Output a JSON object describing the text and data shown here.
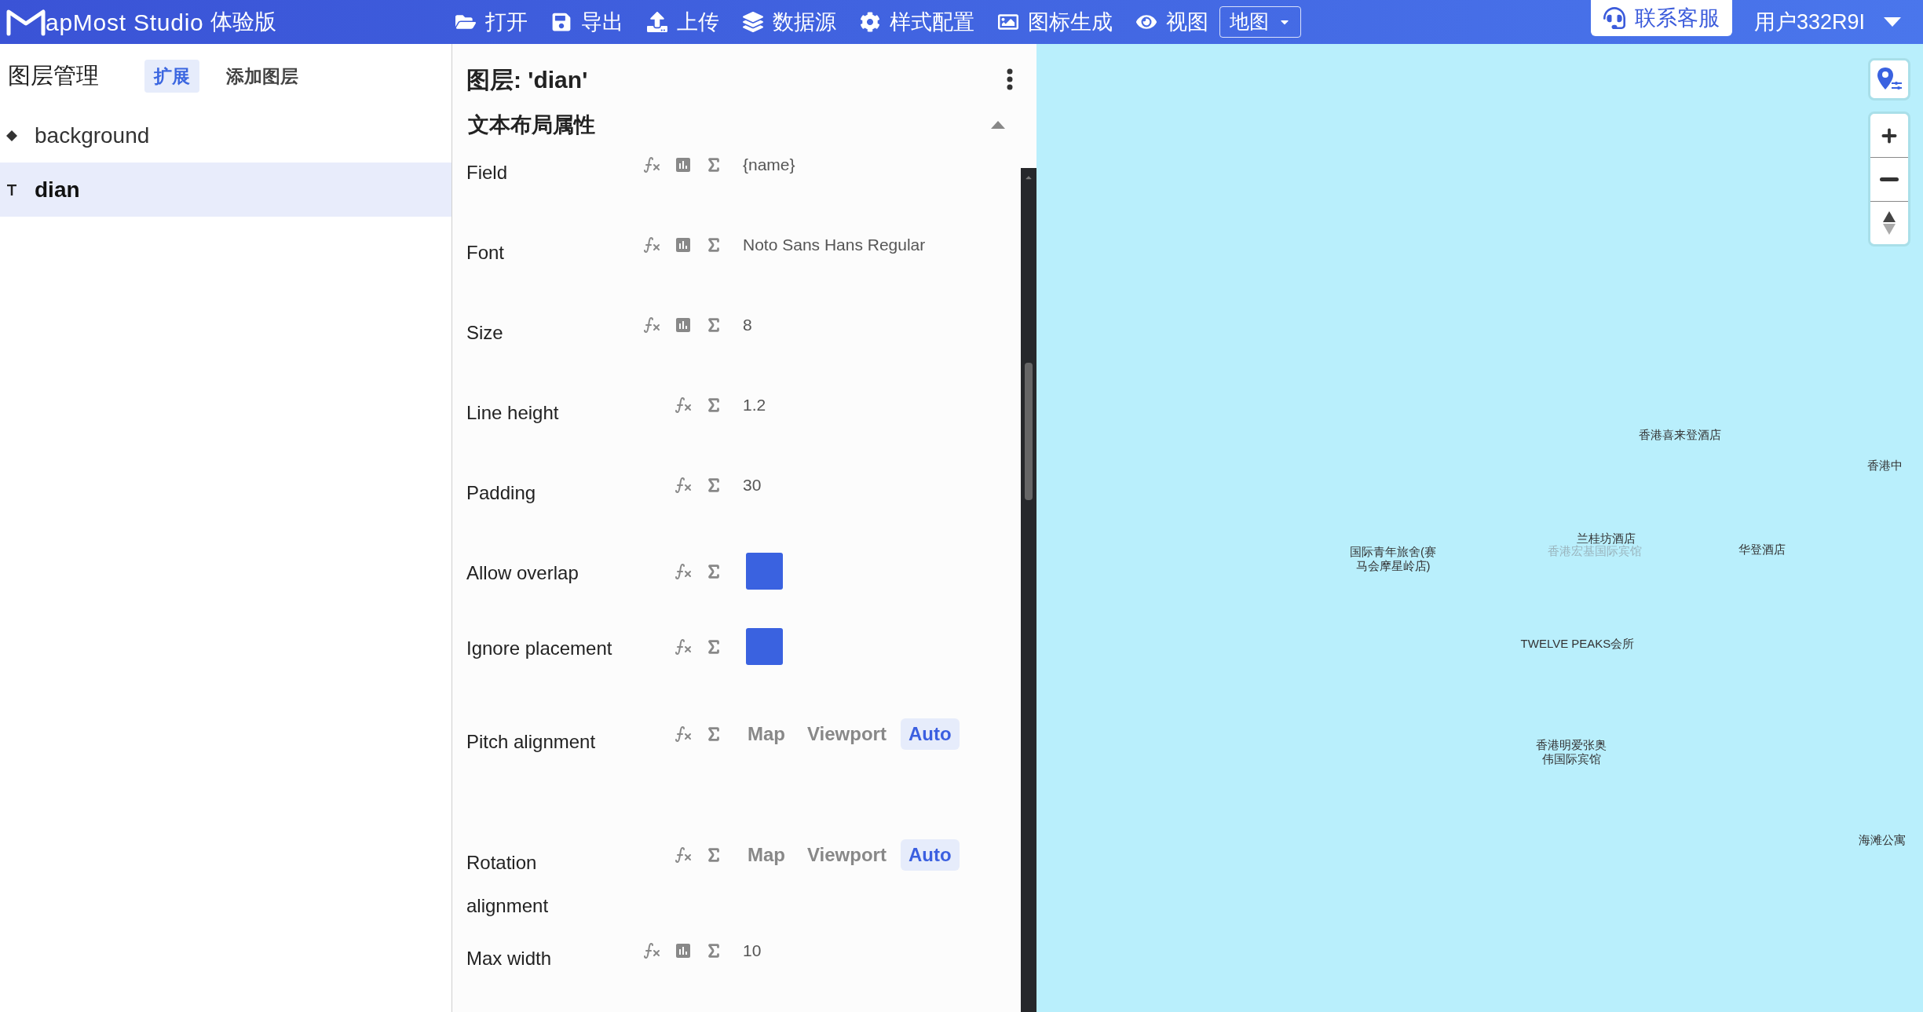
{
  "topbar": {
    "brand": "apMost Studio",
    "edition": "体验版",
    "menu": [
      {
        "kind": "open",
        "label": "打开"
      },
      {
        "kind": "save",
        "label": "导出"
      },
      {
        "kind": "upload",
        "label": "上传"
      },
      {
        "kind": "layers",
        "label": "数据源"
      },
      {
        "kind": "settings",
        "label": "样式配置"
      },
      {
        "kind": "image",
        "label": "图标生成"
      },
      {
        "kind": "view",
        "label": "视图"
      }
    ],
    "view_select": "地图",
    "support": "联系客服",
    "user": "用户332R9I"
  },
  "layers_panel": {
    "title": "图层管理",
    "actions": [
      {
        "label": "扩展",
        "selected": true
      },
      {
        "label": "添加图层",
        "selected": false
      }
    ],
    "layers": [
      {
        "kind": "fill",
        "name": "background",
        "selected": false
      },
      {
        "kind": "symbol",
        "name": "dian",
        "selected": true
      }
    ]
  },
  "editor": {
    "title": "图层: 'dian'",
    "section": {
      "title": "文本布局属性",
      "expanded": true
    },
    "properties": [
      {
        "kind": "text",
        "label": "Field",
        "data_driven": true,
        "value": "{name}"
      },
      {
        "kind": "text",
        "label": "Font",
        "data_driven": true,
        "value": "Noto Sans Hans Regular"
      },
      {
        "kind": "text",
        "label": "Size",
        "data_driven": true,
        "value": "8"
      },
      {
        "kind": "text",
        "label": "Line height",
        "data_driven": false,
        "value": "1.2"
      },
      {
        "kind": "text",
        "label": "Padding",
        "data_driven": false,
        "value": "30"
      },
      {
        "kind": "bool",
        "label": "Allow overlap",
        "data_driven": false,
        "checked": true
      },
      {
        "kind": "bool",
        "label": "Ignore placement",
        "data_driven": false,
        "checked": true
      },
      {
        "kind": "enum",
        "label": "Pitch alignment",
        "data_driven": false,
        "options": [
          {
            "label": "Map",
            "selected": false
          },
          {
            "label": "Viewport",
            "selected": false
          },
          {
            "label": "Auto",
            "selected": true
          }
        ]
      },
      {
        "kind": "enum",
        "label": "Rotation alignment",
        "data_driven": false,
        "options": [
          {
            "label": "Map",
            "selected": false
          },
          {
            "label": "Viewport",
            "selected": false
          },
          {
            "label": "Auto",
            "selected": true
          }
        ]
      },
      {
        "kind": "text",
        "label": "Max width",
        "data_driven": true,
        "value": "10"
      }
    ]
  },
  "map": {
    "labels": [
      {
        "text": "香港喜来登酒店",
        "faded": false
      },
      {
        "text": "香港中",
        "faded": false
      },
      {
        "text": "国际青年旅舍(赛马会摩星岭店)",
        "faded": false
      },
      {
        "text": "兰桂坊酒店",
        "faded": false
      },
      {
        "text": "香港宏基国际宾馆",
        "faded": true
      },
      {
        "text": "华登酒店",
        "faded": false
      },
      {
        "text": "TWELVE PEAKS会所",
        "faded": false
      },
      {
        "text": "香港明爱张奥伟国际宾馆",
        "faded": false
      },
      {
        "text": "海滩公寓",
        "faded": false
      }
    ]
  }
}
